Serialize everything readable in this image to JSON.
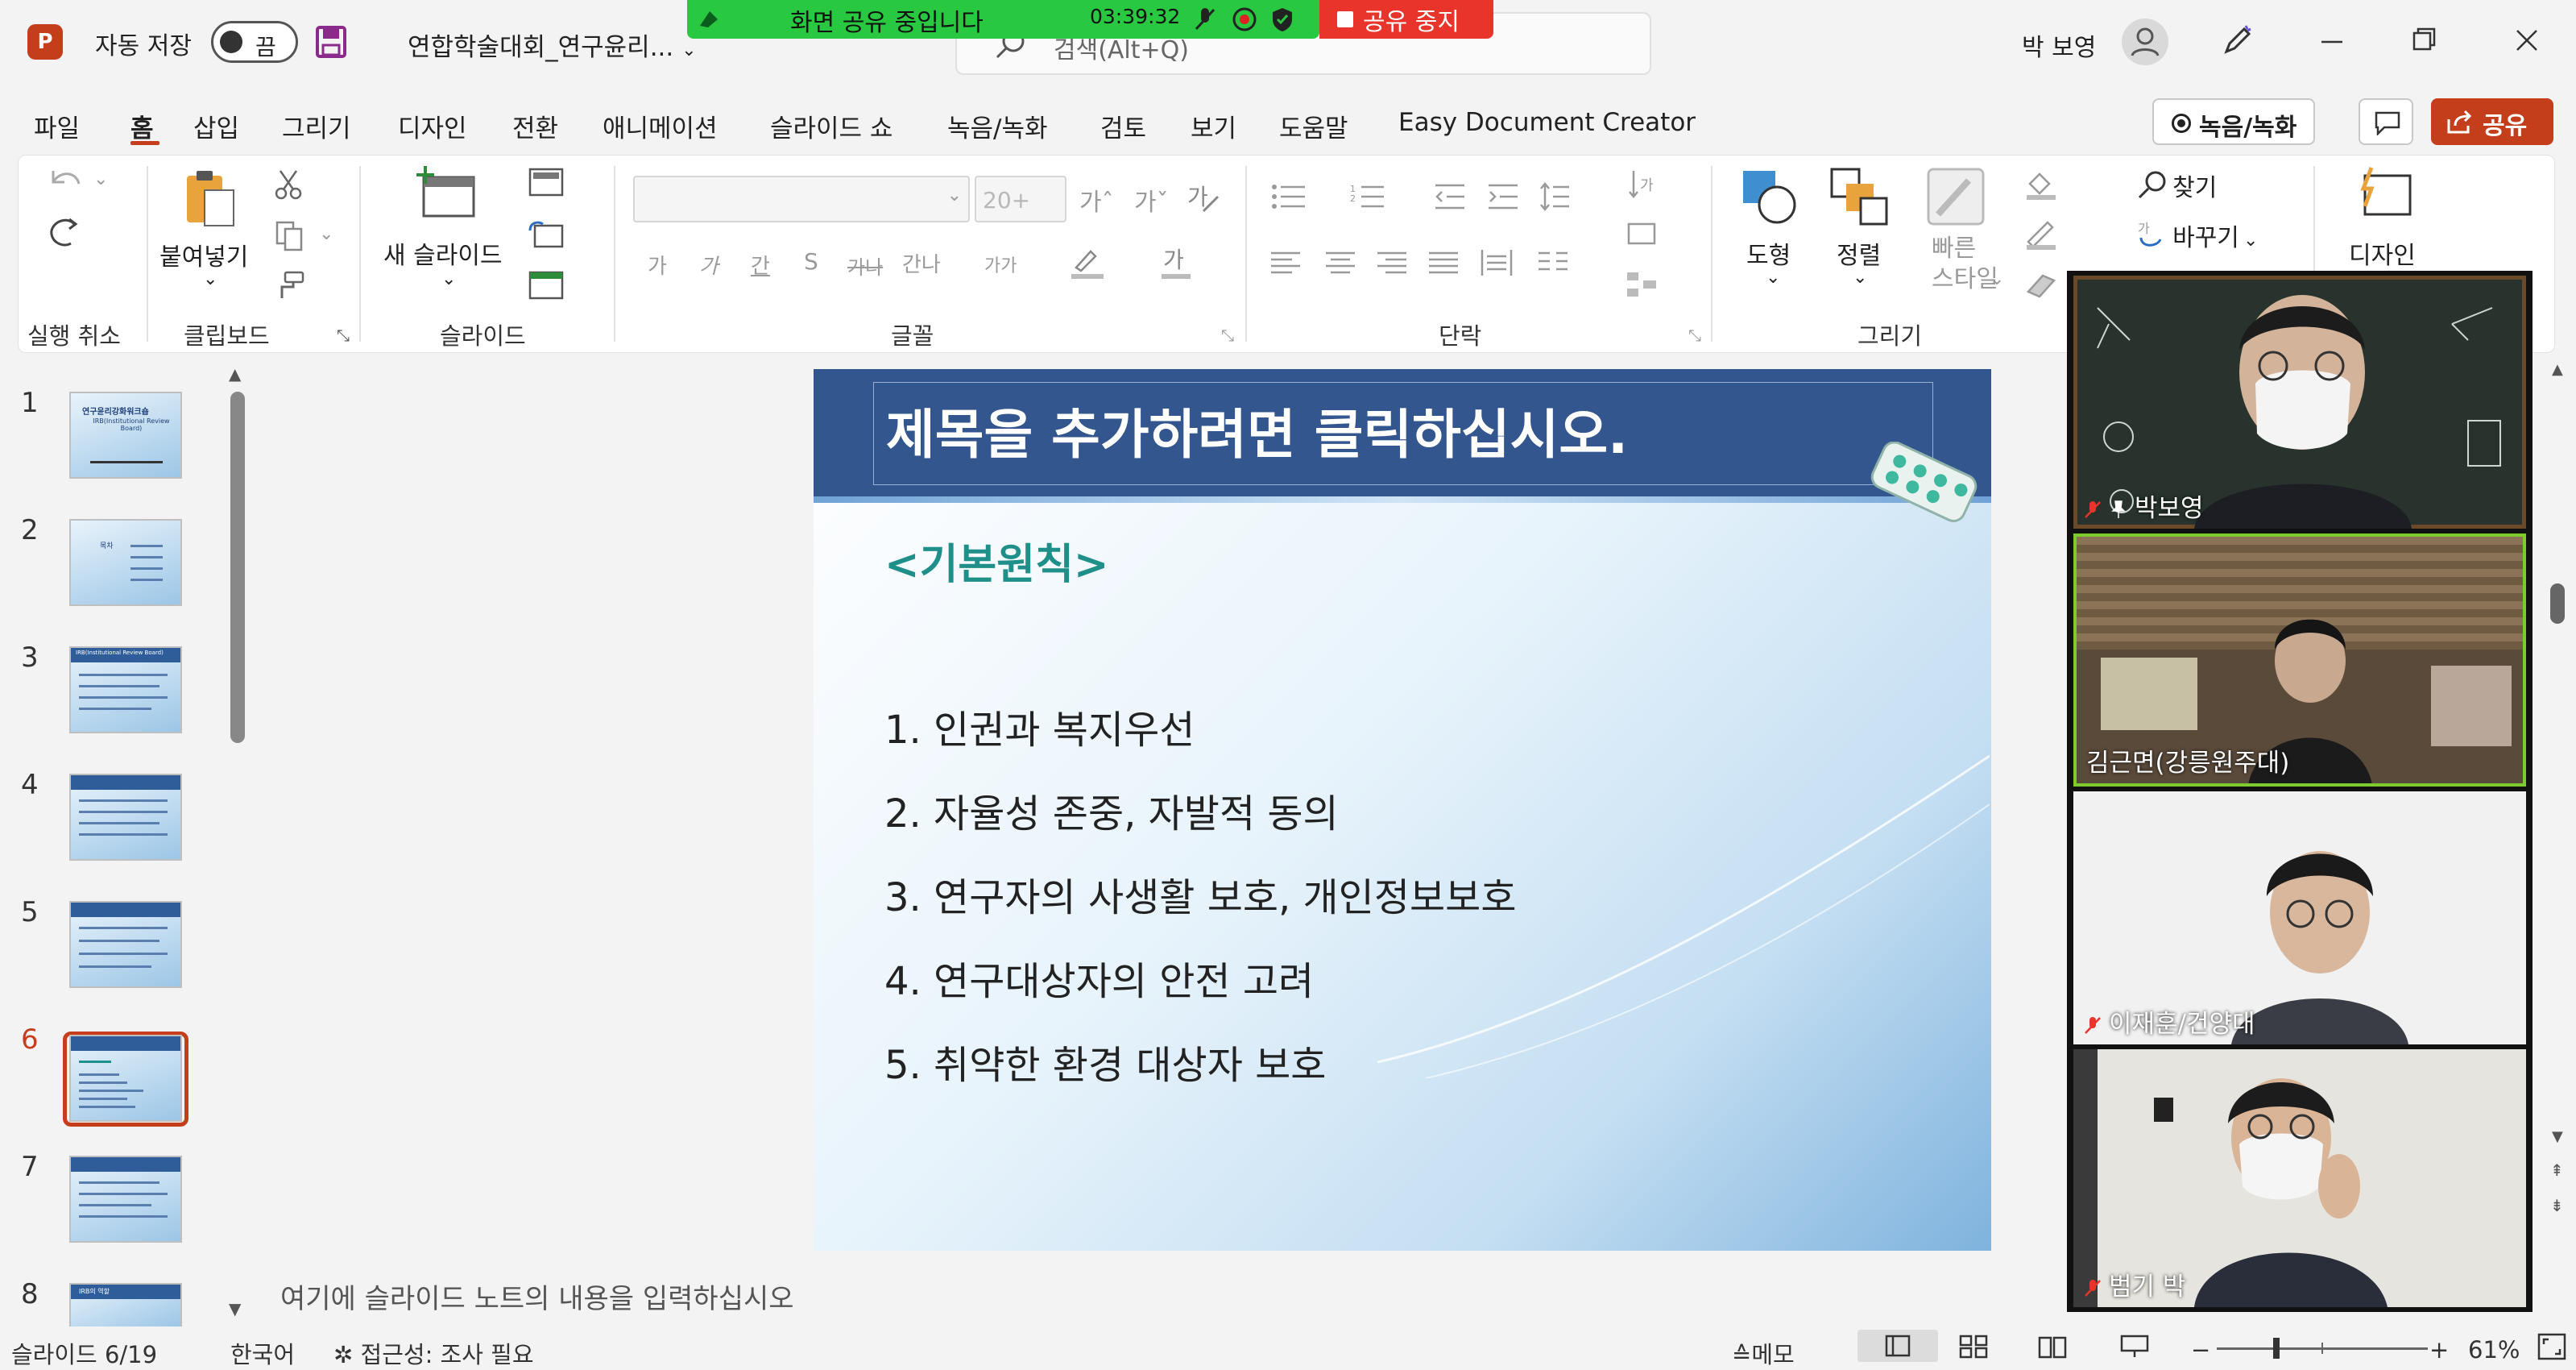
{
  "titlebar": {
    "app_logo": "P",
    "autosave_label": "자동 저장",
    "autosave_state": "끔",
    "doc_title": "연합학술대회_연구윤리...",
    "search_placeholder": "검색(Alt+Q)",
    "user": "박 보영"
  },
  "share_banner": {
    "message": "화면 공유 중입니다",
    "time": "03:39:32",
    "stop_label": "공유 중지"
  },
  "menu": {
    "items": [
      "파일",
      "홈",
      "삽입",
      "그리기",
      "디자인",
      "전환",
      "애니메이션",
      "슬라이드 쇼",
      "녹음/녹화",
      "검토",
      "보기",
      "도움말",
      "Easy Document Creator"
    ],
    "active": "홈",
    "record_label": "녹음/녹화",
    "share_label": "공유"
  },
  "ribbon": {
    "groups": {
      "undo": "실행 취소",
      "clipboard": "클립보드",
      "slides": "슬라이드",
      "font": "글꼴",
      "paragraph": "단락",
      "drawing": "그리기"
    },
    "paste_label": "붙여넣기",
    "new_slide_label": "새 슬라이드",
    "font_size": "20+",
    "shape_label": "도형",
    "arrange_label": "정렬",
    "quick_style_label": "빠른\n스타일",
    "find_label": "찾기",
    "replace_label": "바꾸기",
    "designer_label": "디자인",
    "font_buttons": [
      "가",
      "가",
      "간",
      "S",
      "가나",
      "간나",
      "가가"
    ],
    "grow_font": "가",
    "shrink_font": "가"
  },
  "thumbnails": {
    "numbers": [
      "1",
      "2",
      "3",
      "4",
      "5",
      "6",
      "7",
      "8"
    ],
    "selected": "6",
    "slide1_title": "연구윤리강화워크숍",
    "slide1_sub": "IRB(Institutional Review Board)",
    "slide2_title": "목차",
    "slide3_title": "IRB(Institutional Review Board)",
    "slide8_title": "IRB의 역할"
  },
  "slide": {
    "title": "제목을 추가하려면 클릭하십시오.",
    "principle": "<기본원칙>",
    "items": [
      "1.  인권과 복지우선",
      "2.  자율성 존중, 자발적 동의",
      "3.  연구자의 사생활 보호, 개인정보보호",
      "4.  연구대상자의 안전 고려",
      "5.  취약한 환경 대상자 보호"
    ]
  },
  "notes": {
    "placeholder": "여기에 슬라이드 노트의 내용을 입력하십시오"
  },
  "status": {
    "slide": "슬라이드 6/19",
    "language": "한국어",
    "accessibility": "접근성: 조사 필요",
    "notes_btn": "메모",
    "zoom": "61%"
  },
  "participants": [
    {
      "name": "박보영",
      "muted": true,
      "pinned": true
    },
    {
      "name": "김근면(강릉원주대)",
      "muted": false,
      "pinned": false
    },
    {
      "name": "이재훈/건양대",
      "muted": true,
      "pinned": false
    },
    {
      "name": "범기 박",
      "muted": true,
      "pinned": false
    }
  ],
  "colors": {
    "accent": "#c43e1c",
    "share_green": "#28c840",
    "stop_red": "#e8342a",
    "slide_header": "#34568f",
    "principle_teal": "#1f8f8a"
  }
}
